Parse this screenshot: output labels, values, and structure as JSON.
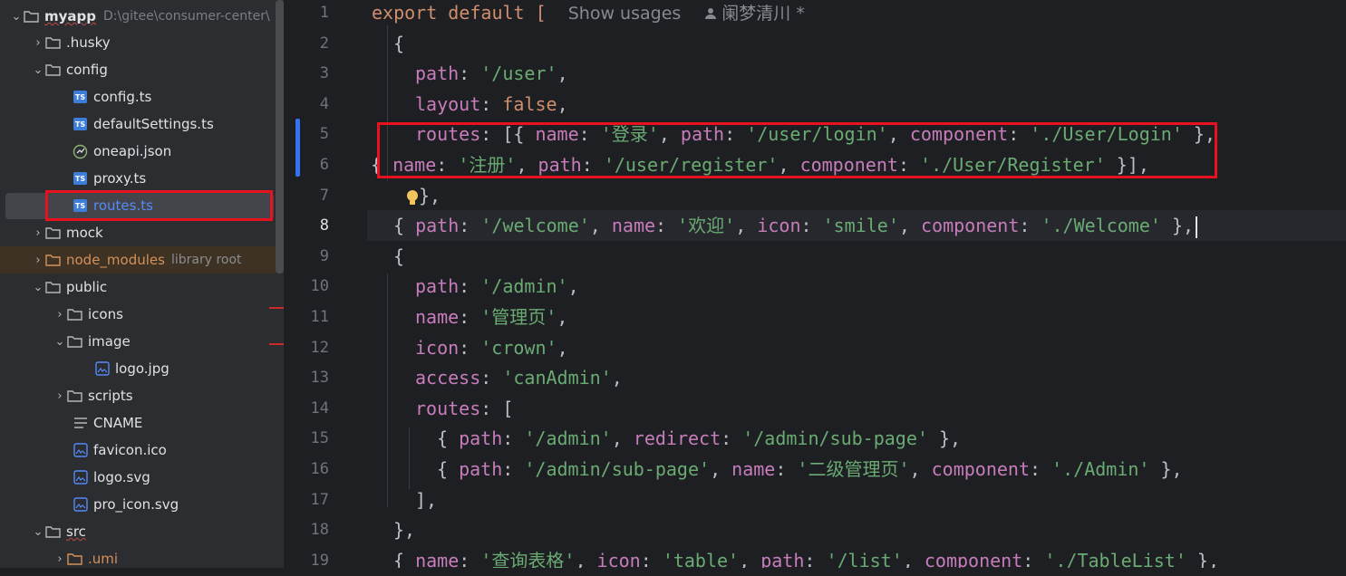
{
  "tree": {
    "root": {
      "name": "myapp",
      "path": "D:\\gitee\\consumer-center\\"
    },
    "items": [
      {
        "name": ".husky"
      },
      {
        "name": "config"
      },
      {
        "name": "config.ts",
        "icon": "ts-file-icon"
      },
      {
        "name": "defaultSettings.ts",
        "icon": "ts-file-icon"
      },
      {
        "name": "oneapi.json",
        "icon": "json-file-icon"
      },
      {
        "name": "proxy.ts",
        "icon": "ts-file-icon"
      },
      {
        "name": "routes.ts",
        "icon": "ts-file-icon"
      },
      {
        "name": "mock"
      },
      {
        "name": "node_modules",
        "hint": "library root"
      },
      {
        "name": "public"
      },
      {
        "name": "icons"
      },
      {
        "name": "image"
      },
      {
        "name": "logo.jpg",
        "icon": "image-file-icon"
      },
      {
        "name": "scripts"
      },
      {
        "name": "CNAME",
        "icon": "text-file-icon"
      },
      {
        "name": "favicon.ico",
        "icon": "image-file-icon"
      },
      {
        "name": "logo.svg",
        "icon": "image-file-icon"
      },
      {
        "name": "pro_icon.svg",
        "icon": "image-file-icon"
      },
      {
        "name": "src"
      },
      {
        "name": ".umi"
      }
    ]
  },
  "editor": {
    "line_numbers": [
      "1",
      "2",
      "3",
      "4",
      "5",
      "6",
      "7",
      "8",
      "9",
      "10",
      "11",
      "12",
      "13",
      "14",
      "15",
      "16",
      "17",
      "18",
      "19"
    ],
    "current_line": "8",
    "inlay_usages": "Show usages",
    "inlay_author": "阑梦清川 *",
    "lines": [
      [
        "export default [  "
      ],
      [
        "{"
      ],
      [
        "path",
        ": ",
        "'/user'",
        ","
      ],
      [
        "layout",
        ": ",
        "false",
        ","
      ],
      [
        "routes",
        ": [{ ",
        "name",
        ": ",
        "'登录'",
        ", ",
        "path",
        ": ",
        "'/user/login'",
        ", ",
        "component",
        ": ",
        "'./User/Login'",
        " },"
      ],
      [
        "{ ",
        "name",
        ": ",
        "'注册'",
        ", ",
        "path",
        ": ",
        "'/user/register'",
        ", ",
        "component",
        ": ",
        "'./User/Register'",
        " }],"
      ],
      [
        "},"
      ],
      [
        "{ ",
        "path",
        ": ",
        "'/welcome'",
        ", ",
        "name",
        ": ",
        "'欢迎'",
        ", ",
        "icon",
        ": ",
        "'smile'",
        ", ",
        "component",
        ": ",
        "'./Welcome'",
        " },"
      ],
      [
        "{"
      ],
      [
        "path",
        ": ",
        "'/admin'",
        ","
      ],
      [
        "name",
        ": ",
        "'管理页'",
        ","
      ],
      [
        "icon",
        ": ",
        "'crown'",
        ","
      ],
      [
        "access",
        ": ",
        "'canAdmin'",
        ","
      ],
      [
        "routes",
        ": ["
      ],
      [
        "{ ",
        "path",
        ": ",
        "'/admin'",
        ", ",
        "redirect",
        ": ",
        "'/admin/sub-page'",
        " },"
      ],
      [
        "{ ",
        "path",
        ": ",
        "'/admin/sub-page'",
        ", ",
        "name",
        ": ",
        "'二级管理页'",
        ", ",
        "component",
        ": ",
        "'./Admin'",
        " },"
      ],
      [
        "],"
      ],
      [
        "},"
      ],
      [
        "{ ",
        "name",
        ": ",
        "'查询表格'",
        ", ",
        "icon",
        ": ",
        "'table'",
        ", ",
        "path",
        ": ",
        "'/list'",
        ", ",
        "component",
        ": ",
        "'./TableList'",
        " },"
      ]
    ]
  },
  "colors": {
    "highlight_box": "#e8121e",
    "keyword": "#cf8e6d",
    "property": "#c77dbb",
    "string": "#6aab73"
  }
}
